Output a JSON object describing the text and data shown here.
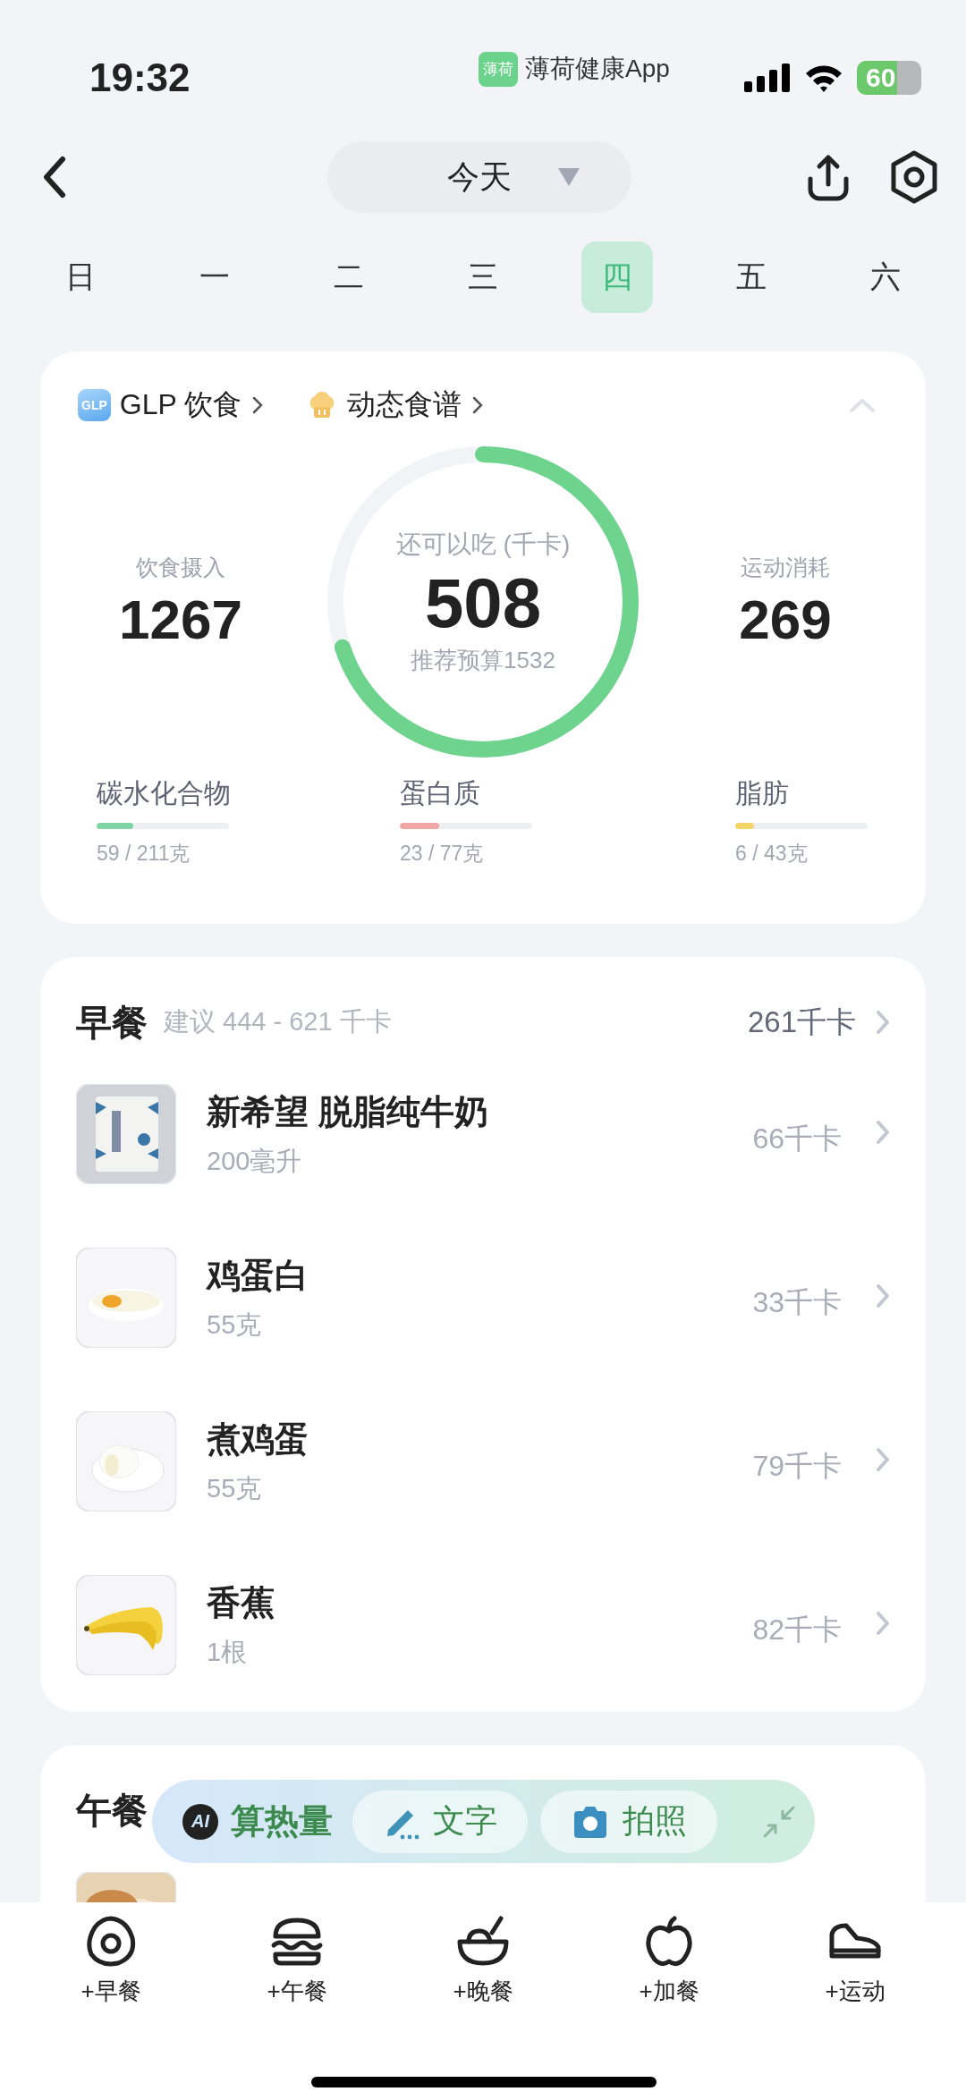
{
  "status_bar": {
    "time": "19:32",
    "app_badge": "薄荷",
    "app_name": "薄荷健康App",
    "battery": "60"
  },
  "nav": {
    "date": "今天"
  },
  "weekdays": [
    {
      "label": "日",
      "selected": false
    },
    {
      "label": "一",
      "selected": false
    },
    {
      "label": "二",
      "selected": false
    },
    {
      "label": "三",
      "selected": false
    },
    {
      "label": "四",
      "selected": true
    },
    {
      "label": "五",
      "selected": false
    },
    {
      "label": "六",
      "selected": false
    }
  ],
  "summary": {
    "expanded": true,
    "glp_link": {
      "badge": "GLP",
      "label": "GLP 饮食"
    },
    "recipe_link": {
      "label": "动态食谱"
    },
    "intake": {
      "label": "饮食摄入",
      "value": "1267"
    },
    "remaining": {
      "label": "还可以吃 (千卡)",
      "value": "508",
      "budget": "推荐预算1532",
      "level": 0.7
    },
    "exercise": {
      "label": "运动消耗",
      "value": "269"
    },
    "macros": [
      {
        "name": "碳水化合物",
        "level": 0.28,
        "color": "#7fd4a6",
        "reading": "59 / 211克"
      },
      {
        "name": "蛋白质",
        "level": 0.3,
        "color": "#f3a7a5",
        "reading": "23 / 77克"
      },
      {
        "name": "脂肪",
        "level": 0.14,
        "color": "#f6d568",
        "reading": "6 / 43克"
      }
    ]
  },
  "meals": [
    {
      "title": "早餐",
      "suggestion": "建议 444 - 621 千卡",
      "total": "261千卡",
      "items": [
        {
          "name": "新希望 脱脂纯牛奶",
          "amount": "200毫升",
          "kcal": "66千卡"
        },
        {
          "name": "鸡蛋白",
          "amount": "55克",
          "kcal": "33千卡"
        },
        {
          "name": "煮鸡蛋",
          "amount": "55克",
          "kcal": "79千卡"
        },
        {
          "name": "香蕉",
          "amount": "1根",
          "kcal": "82千卡"
        }
      ]
    },
    {
      "title": "午餐"
    }
  ],
  "ai_bar": {
    "badge": "AI",
    "title": "算热量",
    "actions": [
      {
        "label": "文字"
      },
      {
        "label": "拍照"
      }
    ]
  },
  "bottom_nav": [
    {
      "label": "+早餐"
    },
    {
      "label": "+午餐"
    },
    {
      "label": "+晚餐"
    },
    {
      "label": "+加餐"
    },
    {
      "label": "+运动"
    }
  ]
}
